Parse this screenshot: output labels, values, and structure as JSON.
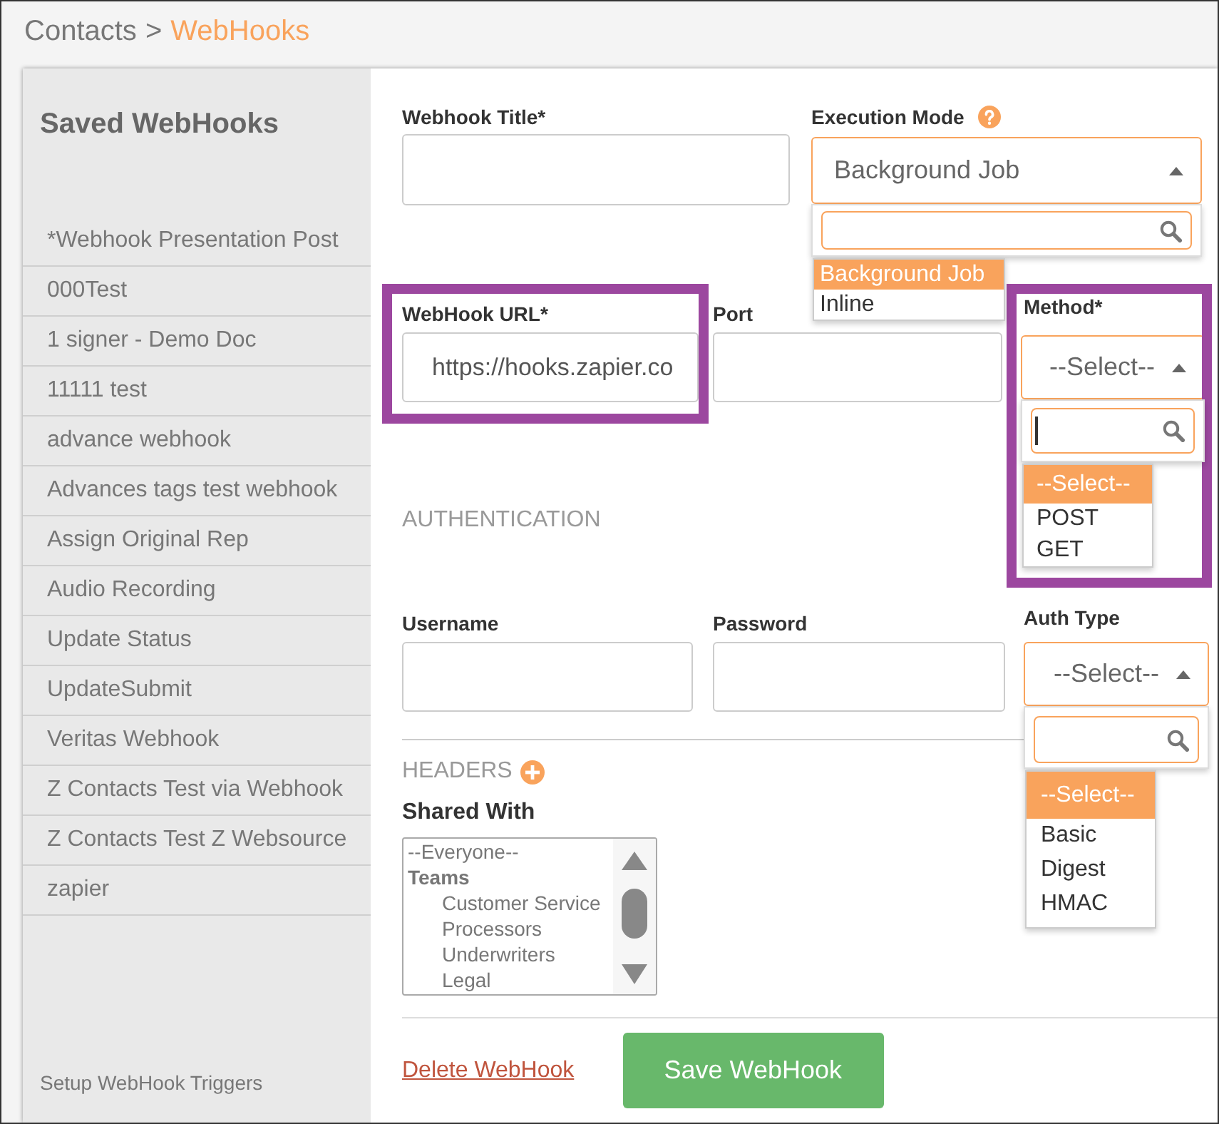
{
  "breadcrumb": {
    "separator": ">",
    "items": [
      {
        "label": "Contacts",
        "current": false
      },
      {
        "label": "WebHooks",
        "current": true
      }
    ]
  },
  "sidebar": {
    "title": "Saved WebHooks",
    "items": [
      "*Webhook Presentation Post",
      "000Test",
      "1 signer - Demo Doc",
      "11111 test",
      "advance webhook",
      "Advances tags test webhook",
      "Assign Original Rep",
      "Audio Recording",
      "Update Status",
      "UpdateSubmit",
      "Veritas Webhook",
      "Z Contacts Test via Webhook",
      "Z Contacts Test Z Websource",
      "zapier"
    ],
    "footer_link": "Setup WebHook Triggers"
  },
  "form": {
    "title_field": {
      "label": "Webhook Title*"
    },
    "execution_mode": {
      "label": "Execution Mode",
      "value": "Background Job",
      "expanded": true,
      "search_focused": false,
      "options": [
        {
          "label": "Background Job",
          "selected": true
        },
        {
          "label": "Inline",
          "selected": false
        }
      ]
    },
    "url_field": {
      "label": "WebHook URL*",
      "value": "https://hooks.zapier.co",
      "highlighted": true
    },
    "port_field": {
      "label": "Port"
    },
    "method": {
      "label": "Method*",
      "value": "--Select--",
      "expanded": true,
      "search_focused": true,
      "highlighted": true,
      "options": [
        {
          "label": "--Select--",
          "selected": true
        },
        {
          "label": "POST",
          "selected": false
        },
        {
          "label": "GET",
          "selected": false
        }
      ]
    },
    "authentication": {
      "heading": "AUTHENTICATION",
      "username_field": {
        "label": "Username"
      },
      "password_field": {
        "label": "Password"
      },
      "auth_type": {
        "label": "Auth Type",
        "value": "--Select--",
        "expanded": true,
        "search_focused": false,
        "options": [
          {
            "label": "--Select--",
            "selected": true
          },
          {
            "label": "Basic",
            "selected": false
          },
          {
            "label": "Digest",
            "selected": false
          },
          {
            "label": "HMAC",
            "selected": false
          }
        ]
      }
    },
    "headers": {
      "heading": "HEADERS"
    },
    "shared_with": {
      "label": "Shared With",
      "options": [
        {
          "kind": "option",
          "label": "--Everyone--"
        },
        {
          "kind": "group",
          "label": "Teams",
          "children": [
            {
              "label": "Customer Service"
            },
            {
              "label": "Processors"
            },
            {
              "label": "Underwriters"
            },
            {
              "label": "Legal"
            }
          ]
        }
      ]
    },
    "actions": {
      "delete_link": "Delete WebHook",
      "save_button": "Save WebHook"
    }
  }
}
